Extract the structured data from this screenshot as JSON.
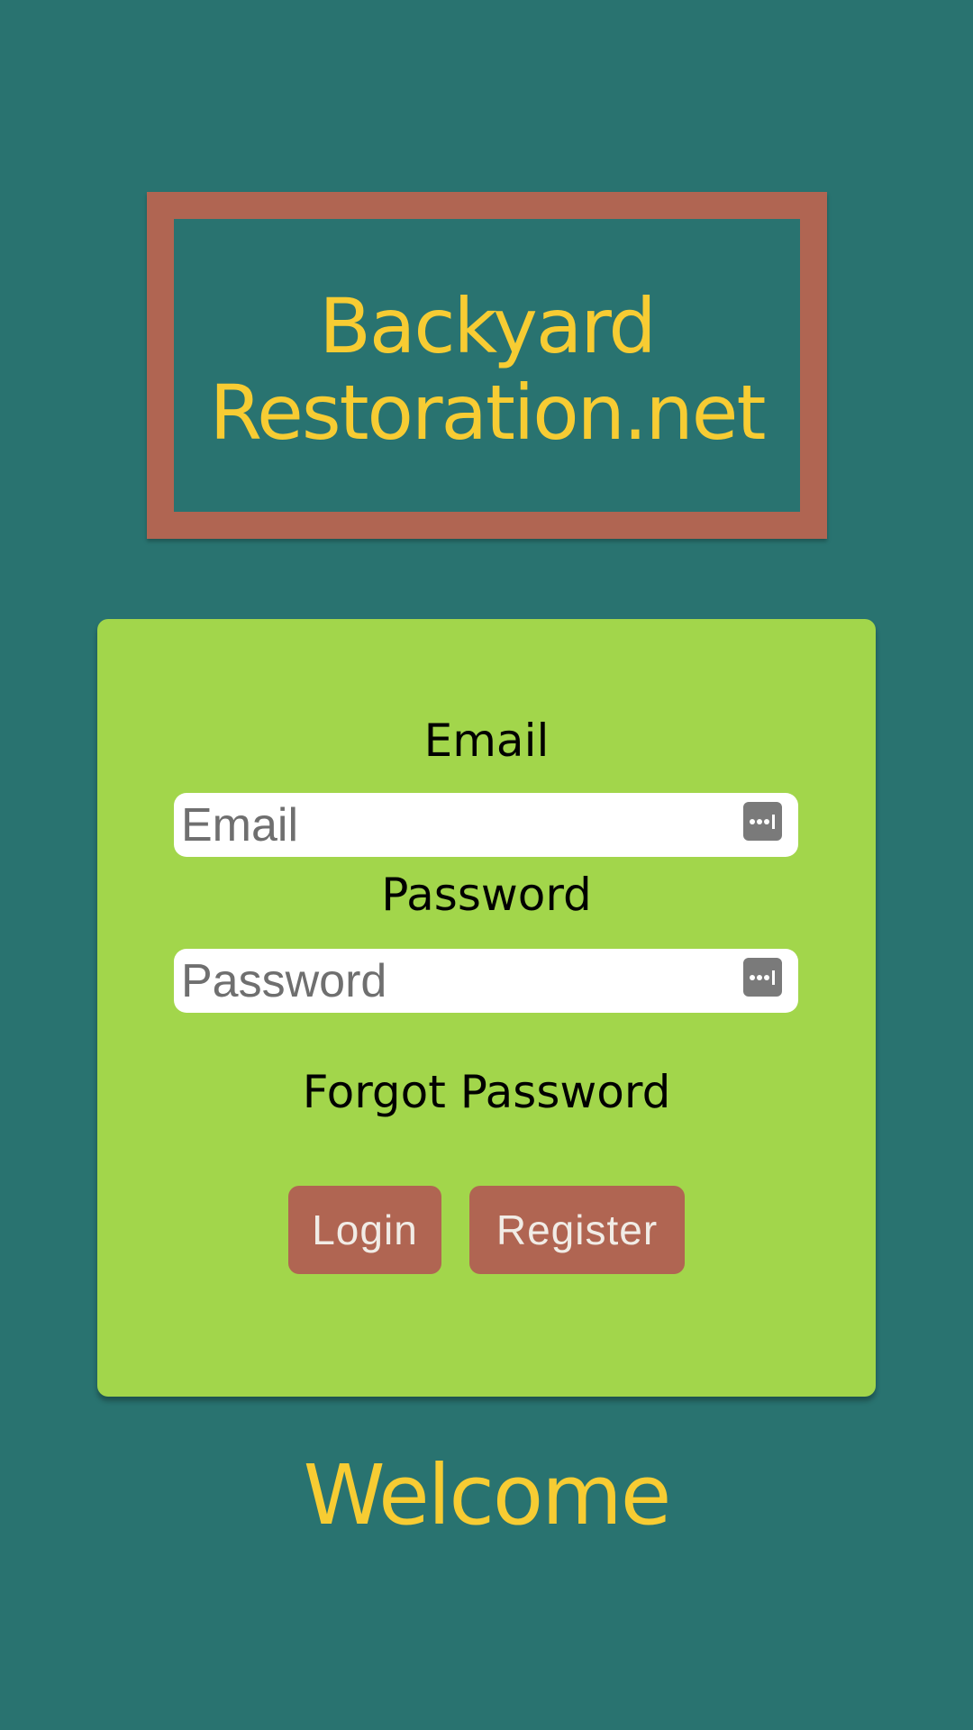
{
  "logo": {
    "line1": "Backyard",
    "line2": "Restoration.net"
  },
  "form": {
    "email_label": "Email",
    "email_placeholder": "Email",
    "password_label": "Password",
    "password_placeholder": "Password",
    "password_manager_icon": "password-manager-icon",
    "forgot_link": "Forgot Password",
    "login_button": "Login",
    "register_button": "Register"
  },
  "welcome": "Welcome",
  "colors": {
    "background": "#297370",
    "logo_border": "#b06552",
    "accent_text": "#f7cc33",
    "card": "#a2d64b",
    "button": "#b06552"
  }
}
